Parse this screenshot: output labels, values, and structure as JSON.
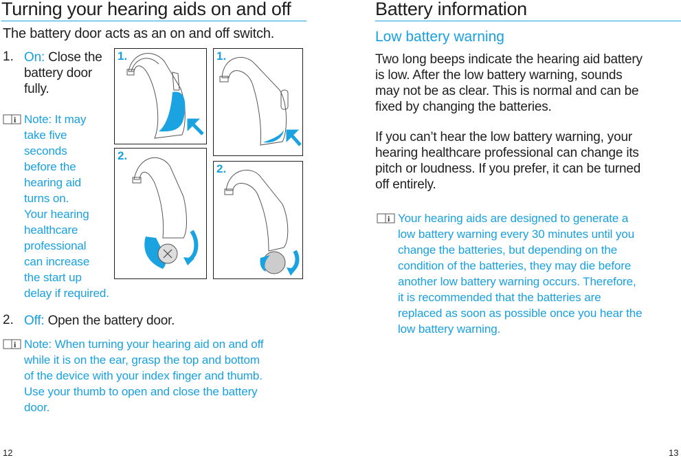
{
  "left_page": {
    "title": "Turning your hearing aids on and off",
    "intro": "The battery door acts as an on and off switch.",
    "steps": [
      {
        "number": "1.",
        "label": "On:",
        "text_lines": [
          "Close the",
          "battery door",
          "fully."
        ]
      },
      {
        "number": "2.",
        "label": "Off:",
        "text": "Open the battery door."
      }
    ],
    "note1_lines": [
      "Note: It may",
      "take five",
      "seconds",
      "before the",
      "hearing aid",
      "turns on.",
      "Your hearing",
      "healthcare",
      "professional",
      "can increase",
      "the start up",
      "delay if required."
    ],
    "note2_lines": [
      "Note: When turning your hearing aid on and off",
      "while it is on the ear, grasp the top and bottom",
      "of the device with your index finger and thumb.",
      "Use your thumb to open and close the battery",
      "door."
    ],
    "figures": [
      {
        "label": "1.",
        "description": "Hearing aid with battery door closed (blue), arrow pushing door in",
        "icon": "hearing-aid-door-closed"
      },
      {
        "label": "1.",
        "description": "Hearing aid variant with battery door closed (blue), arrow pushing door in",
        "icon": "hearing-aid-door-closed"
      },
      {
        "label": "2.",
        "description": "Hearing aid with battery door open showing battery, curved arrow",
        "icon": "hearing-aid-door-open"
      },
      {
        "label": "2.",
        "description": "Hearing aid variant with battery door open showing battery, curved arrow",
        "icon": "hearing-aid-door-open"
      }
    ],
    "page_number": "12"
  },
  "right_page": {
    "title": "Battery information",
    "subtitle": "Low battery warning",
    "para1_lines": [
      "Two long beeps indicate the hearing aid battery",
      "is low. After the low battery warning, sounds",
      "may not be as clear. This is normal and can be",
      "fixed by changing the batteries."
    ],
    "para2_lines": [
      "If you can’t hear the low battery warning, your",
      "hearing healthcare professional can change its",
      "pitch or loudness. If you prefer, it can be turned",
      "off entirely."
    ],
    "note_lines": [
      "Your hearing aids are designed to generate a",
      "low battery warning every 30 minutes until you",
      "change the batteries, but depending on the",
      "condition of the batteries, they may die before",
      "another low battery warning occurs. Therefore,",
      "it is recommended that the batteries are",
      "replaced as soon as possible once you hear the",
      "low battery warning."
    ],
    "page_number": "13"
  },
  "colors": {
    "accent": "#18a0e0",
    "text": "#1e1e1e",
    "rule": "#1aa3e0"
  }
}
